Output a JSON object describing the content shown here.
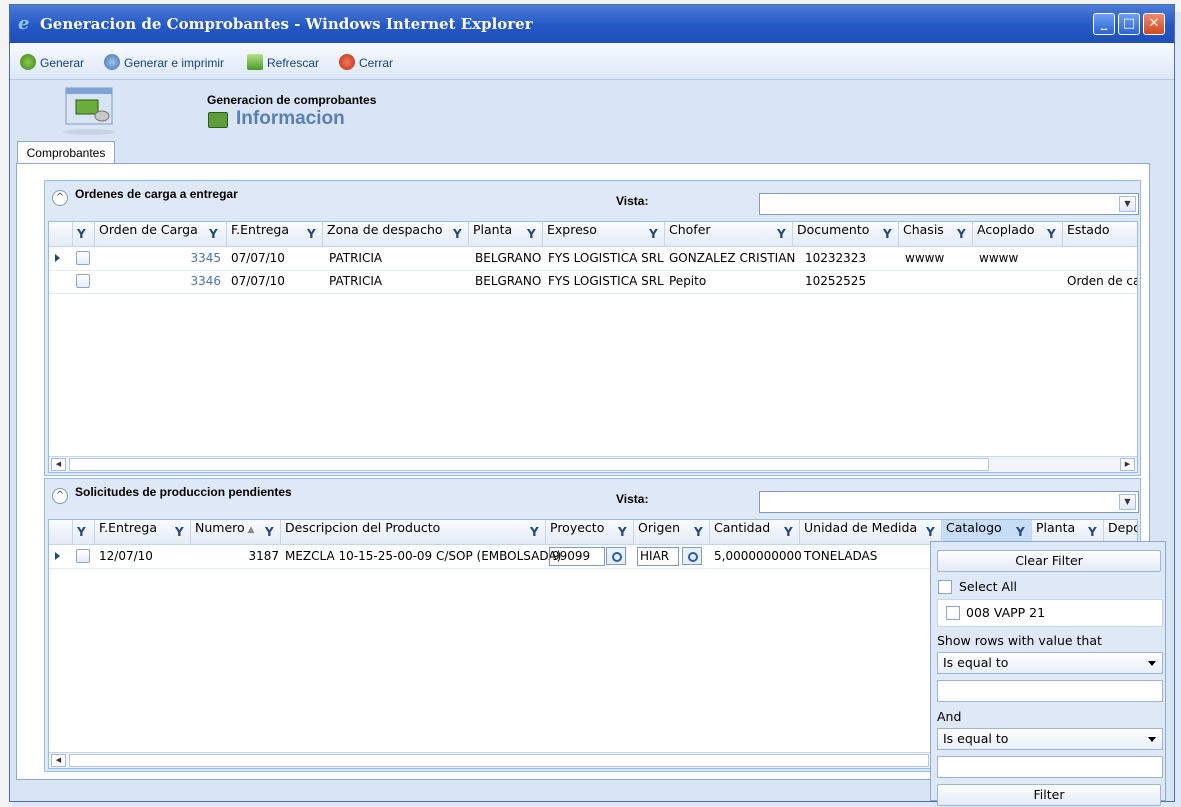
{
  "window": {
    "title": "Generacion de Comprobantes - Windows Internet Explorer"
  },
  "toolbar": {
    "generar": "Generar",
    "generar_imprimir": "Generar e imprimir",
    "refrescar": "Refrescar",
    "cerrar": "Cerrar"
  },
  "header": {
    "subtitle": "Generacion de comprobantes",
    "title": "Informacion"
  },
  "tabs": {
    "comprobantes": "Comprobantes"
  },
  "ordenes": {
    "title": "Ordenes de carga a entregar",
    "vista_label": "Vista:",
    "columns": [
      "Orden de Carga",
      "F.Entrega",
      "Zona de despacho",
      "Planta",
      "Expreso",
      "Chofer",
      "Documento",
      "Chasis",
      "Acoplado",
      "Estado"
    ],
    "rows": [
      {
        "orden": "3345",
        "fecha": "07/07/10",
        "zona": "PATRICIA",
        "planta": "BELGRANO",
        "expreso": "FYS LOGISTICA SRL",
        "chofer": "GONZALEZ CRISTIAN",
        "documento": "10232323",
        "chasis": "wwww",
        "acoplado": "wwww",
        "estado": ""
      },
      {
        "orden": "3346",
        "fecha": "07/07/10",
        "zona": "PATRICIA",
        "planta": "BELGRANO",
        "expreso": "FYS LOGISTICA SRL",
        "chofer": "Pepito",
        "documento": "10252525",
        "chasis": "",
        "acoplado": "",
        "estado": "Orden de car"
      }
    ]
  },
  "solicitudes": {
    "title": "Solicitudes de produccion pendientes",
    "vista_label": "Vista:",
    "columns": [
      "F.Entrega",
      "Numero",
      "Descripcion del Producto",
      "Proyecto",
      "Origen",
      "Cantidad",
      "Unidad de Medida",
      "Catalogo",
      "Planta",
      "Depo"
    ],
    "rows": [
      {
        "fecha": "12/07/10",
        "numero": "3187",
        "descripcion": "MEZCLA 10-15-25-00-09 C/SOP (EMBOLSADA)",
        "proyecto": "99099",
        "origen": "HIAR",
        "cantidad": "5,0000000000",
        "unidad": "TONELADAS"
      }
    ]
  },
  "filter_popup": {
    "clear": "Clear Filter",
    "select_all": "Select All",
    "item": "008 VAPP 21",
    "show_rows": "Show rows with value that",
    "op1": "Is equal to",
    "and": "And",
    "op2": "Is equal to",
    "filter": "Filter"
  }
}
